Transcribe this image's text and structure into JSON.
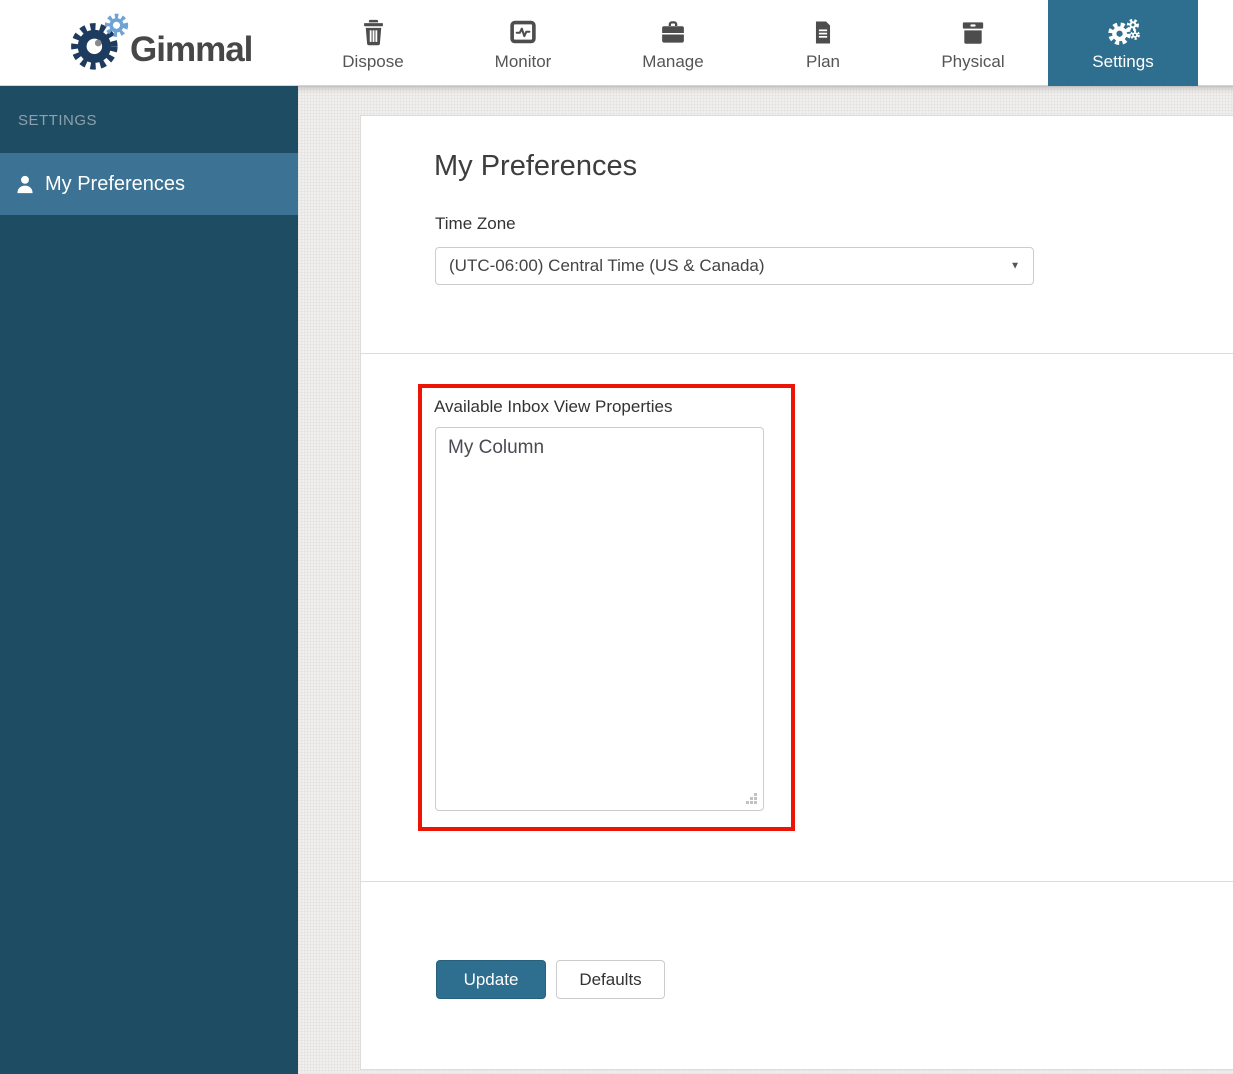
{
  "brand": {
    "name": "Gimmal"
  },
  "nav": {
    "items": [
      {
        "label": "Dispose",
        "icon": "trash-icon",
        "active": false
      },
      {
        "label": "Monitor",
        "icon": "monitor-icon",
        "active": false
      },
      {
        "label": "Manage",
        "icon": "briefcase-icon",
        "active": false
      },
      {
        "label": "Plan",
        "icon": "document-icon",
        "active": false
      },
      {
        "label": "Physical",
        "icon": "archive-box-icon",
        "active": false
      },
      {
        "label": "Settings",
        "icon": "gears-icon",
        "active": true
      }
    ]
  },
  "sidebar": {
    "section_label": "SETTINGS",
    "items": [
      {
        "label": "My Preferences",
        "icon": "person-icon",
        "active": true
      }
    ]
  },
  "main": {
    "title": "My Preferences",
    "time_zone": {
      "label": "Time Zone",
      "selected_option": "(UTC-06:00) Central Time (US & Canada)"
    },
    "inbox_view_properties": {
      "label": "Available Inbox View Properties",
      "options": [
        "My Column"
      ],
      "highlighted_by_red_annotation": true
    },
    "actions": {
      "update_label": "Update",
      "defaults_label": "Defaults"
    }
  },
  "colors": {
    "accent": "#2e6e8e",
    "sidebar-bg": "#1e4d63",
    "sidebar-active": "#3c7294",
    "annotation-red": "#ec1505",
    "logo-dark": "#1d3a5f",
    "logo-light": "#6fa3d6"
  }
}
